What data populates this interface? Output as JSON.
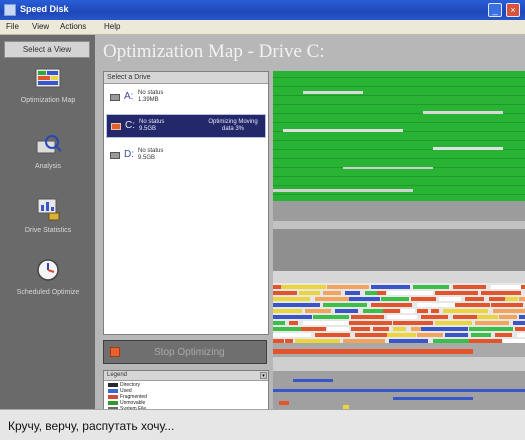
{
  "window": {
    "title": "Speed Disk"
  },
  "menu": {
    "items": [
      "File",
      "View",
      "Actions",
      "Help"
    ]
  },
  "nav": {
    "header": "Select a View",
    "buttons": [
      {
        "label": "Optimization Map",
        "icon": "optimization-map-icon"
      },
      {
        "label": "Analysis",
        "icon": "analysis-icon"
      },
      {
        "label": "Drive Statistics",
        "icon": "drive-statistics-icon"
      },
      {
        "label": "Scheduled Optimize",
        "icon": "schedule-icon"
      }
    ]
  },
  "main": {
    "map_title": "Optimization Map - Drive C:",
    "drive_list_header": "Select a Drive",
    "drives": [
      {
        "letter": "A:",
        "status": "No status",
        "size": "1.39MB",
        "progress": "",
        "selected": false
      },
      {
        "letter": "C:",
        "status": "No status",
        "size": "9.5GB",
        "progress": "Optimizing Moving data 3%",
        "selected": true
      },
      {
        "letter": "D:",
        "status": "No status",
        "size": "9.5GB",
        "progress": "",
        "selected": false
      }
    ],
    "stop_button": "Stop Optimizing",
    "legend": {
      "header": "Legend",
      "items": [
        {
          "label": "Directory",
          "color": "#2a2a2a"
        },
        {
          "label": "Used",
          "color": "#3a6ad0"
        },
        {
          "label": "Fragmented",
          "color": "#d24a3a"
        },
        {
          "label": "Unmovable",
          "color": "#2c9b2c"
        },
        {
          "label": "System File",
          "color": "#6a6a6a"
        }
      ]
    }
  },
  "colors": {
    "free": "#a9a9a9",
    "used_green": "#29b335",
    "used_light": "#d8d8d8",
    "fragmented": "#e2552c",
    "moving_yellow": "#ecd53c",
    "blue": "#3a55c8"
  },
  "caption": "Кручу, верчу, распутать хочу..."
}
